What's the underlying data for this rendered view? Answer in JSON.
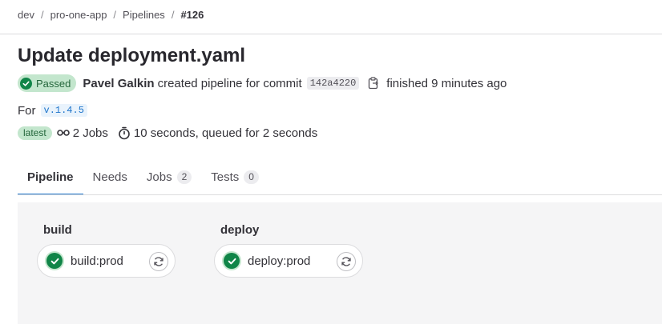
{
  "breadcrumb": {
    "items": [
      "dev",
      "pro-one-app",
      "Pipelines"
    ],
    "current": "#126"
  },
  "page_title": "Update deployment.yaml",
  "status": {
    "label": "Passed",
    "color": "#108548"
  },
  "meta": {
    "author": "Pavel Galkin",
    "created_text": "created pipeline for commit",
    "commit_sha": "142a4220",
    "finished_text": "finished 9 minutes ago"
  },
  "for_row": {
    "label": "For",
    "ref": "v.1.4.5"
  },
  "info": {
    "latest_badge": "latest",
    "jobs_text": "2 Jobs",
    "duration_text": "10 seconds, queued for 2 seconds"
  },
  "tabs": [
    {
      "label": "Pipeline",
      "count": null,
      "active": true
    },
    {
      "label": "Needs",
      "count": null,
      "active": false
    },
    {
      "label": "Jobs",
      "count": "2",
      "active": false
    },
    {
      "label": "Tests",
      "count": "0",
      "active": false
    }
  ],
  "stages": [
    {
      "title": "build",
      "job": "build:prod",
      "icon": "check-circle-icon"
    },
    {
      "title": "deploy",
      "job": "deploy:prod",
      "icon": "check-circle-icon"
    }
  ]
}
